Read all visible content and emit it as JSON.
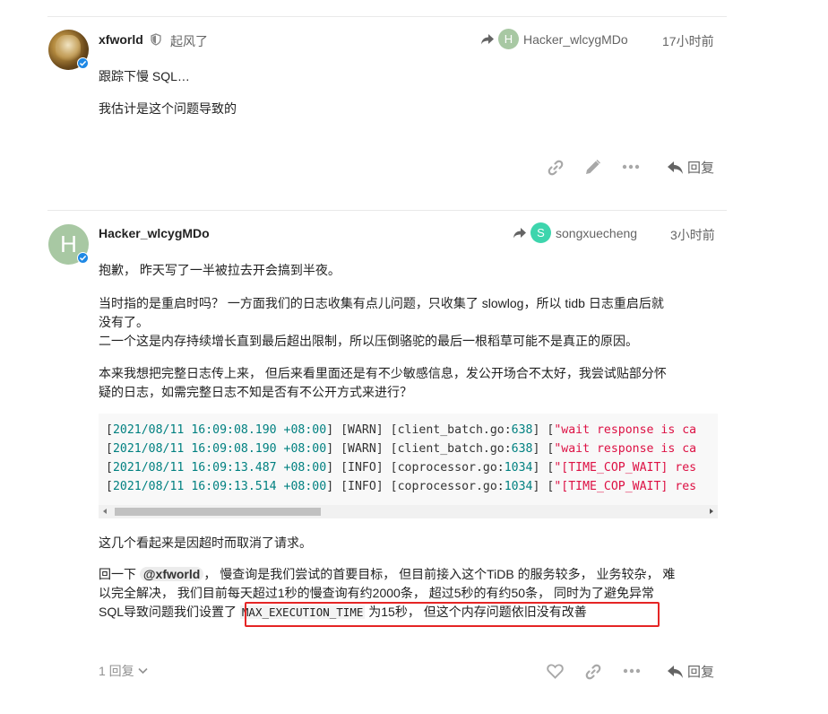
{
  "post1": {
    "username": "xfworld",
    "user_title": "起风了",
    "reply_to_initial": "H",
    "reply_to_name": "Hacker_wlcygMDo",
    "reply_to_color": "#a8c8a3",
    "time": "17小时前",
    "paragraphs": [
      "跟踪下慢 SQL…",
      "我估计是这个问题导致的"
    ],
    "reply_label": "回复",
    "icons": [
      "link-icon",
      "pencil-icon",
      "more-icon",
      "reply-icon"
    ]
  },
  "post2": {
    "avatar_initial": "H",
    "avatar_color": "#a8c8a3",
    "username": "Hacker_wlcygMDo",
    "reply_to_initial": "S",
    "reply_to_name": "songxuecheng",
    "reply_to_color": "#3dd5ad",
    "time": "3小时前",
    "p1": "抱歉， 昨天写了一半被拉去开会搞到半夜。",
    "p2_line1": "当时指的是重启时吗？ 一方面我们的日志收集有点儿问题，只收集了 slowlog，所以 tidb 日志重启后就",
    "p2_line2": "没有了。",
    "p2_line3": "二一个这是内存持续增长直到最后超出限制，所以压倒骆驼的最后一根稻草可能不是真正的原因。",
    "p3_line1": "本来我想把完整日志传上来， 但后来看里面还是有不少敏感信息，发公开场合不太好，我尝试贴部分怀",
    "p3_line2": "疑的日志，如需完整日志不知是否有不公开方式来进行？",
    "code_lines": [
      {
        "date": "2021/08/11",
        "time": "16:09:08.190",
        "tz": "+08:00",
        "level": "WARN",
        "file": "client_batch.go",
        "line": "638",
        "msg": "wait response is ca"
      },
      {
        "date": "2021/08/11",
        "time": "16:09:08.190",
        "tz": "+08:00",
        "level": "WARN",
        "file": "client_batch.go",
        "line": "638",
        "msg": "wait response is ca"
      },
      {
        "date": "2021/08/11",
        "time": "16:09:13.487",
        "tz": "+08:00",
        "level": "INFO",
        "file": "coprocessor.go",
        "line": "1034",
        "msg": "[TIME_COP_WAIT] res"
      },
      {
        "date": "2021/08/11",
        "time": "16:09:13.514",
        "tz": "+08:00",
        "level": "INFO",
        "file": "coprocessor.go",
        "line": "1034",
        "msg": "[TIME_COP_WAIT] res"
      }
    ],
    "p4": "这几个看起来是因超时而取消了请求。",
    "p5_prefix": "回一下 ",
    "p5_mention": "@xfworld",
    "p5_after_mention": "， 慢查询是我们尝试的首要目标， 但目前接入这个TiDB 的服务较多， 业务较杂， 难",
    "p5_line2": "以完全解决， 我们目前每天超过1秒的慢查询有约2000条， 超过5秒的有约50条， 同时为了避免异常",
    "p5_line3_prefix": "SQL导致问题我们设置了 ",
    "p5_code": "MAX_EXECUTION_TIME",
    "p5_line3_suffix": " 为15秒， 但这个内存问题依旧没有改善",
    "replies_count": "1 回复",
    "reply_label": "回复",
    "icons": [
      "heart-icon",
      "link-icon",
      "more-icon",
      "reply-icon"
    ]
  },
  "colors": {
    "highlight_border": "#e52525",
    "verified_badge": "#1e88e5",
    "code_number": "#008080",
    "code_string": "#d14"
  }
}
